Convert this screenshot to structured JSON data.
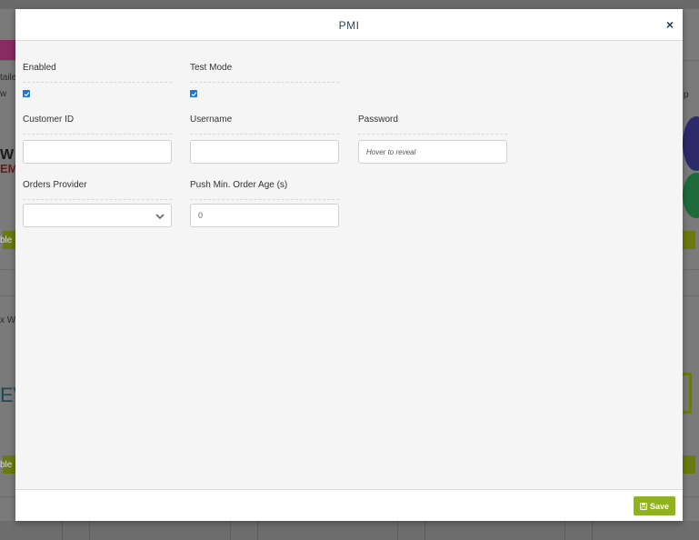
{
  "background": {
    "fragments": [
      "taile",
      "w",
      "W",
      "EM",
      "ble",
      "x Wi",
      "EV",
      "ble",
      "p"
    ]
  },
  "modal": {
    "title": "PMI",
    "close_symbol": "×",
    "fields": {
      "enabled": {
        "label": "Enabled",
        "checked": true
      },
      "test_mode": {
        "label": "Test Mode",
        "checked": true
      },
      "customer_id": {
        "label": "Customer ID",
        "value": ""
      },
      "username": {
        "label": "Username",
        "value": ""
      },
      "password": {
        "label": "Password",
        "placeholder": "Hover to reveal"
      },
      "orders_provider": {
        "label": "Orders Provider",
        "selected": ""
      },
      "push_min_order_age": {
        "label": "Push Min. Order Age (s)",
        "value": "0"
      }
    },
    "footer": {
      "save_label": "Save"
    }
  },
  "colors": {
    "accent_green": "#8fb21e",
    "checkbox_blue": "#1a73e8",
    "title_color": "#2d4654"
  },
  "icons": {
    "close": "close-icon",
    "save": "floppy-disk-icon",
    "dropdown": "chevron-down-icon",
    "checkbox": "checkmark-icon"
  }
}
